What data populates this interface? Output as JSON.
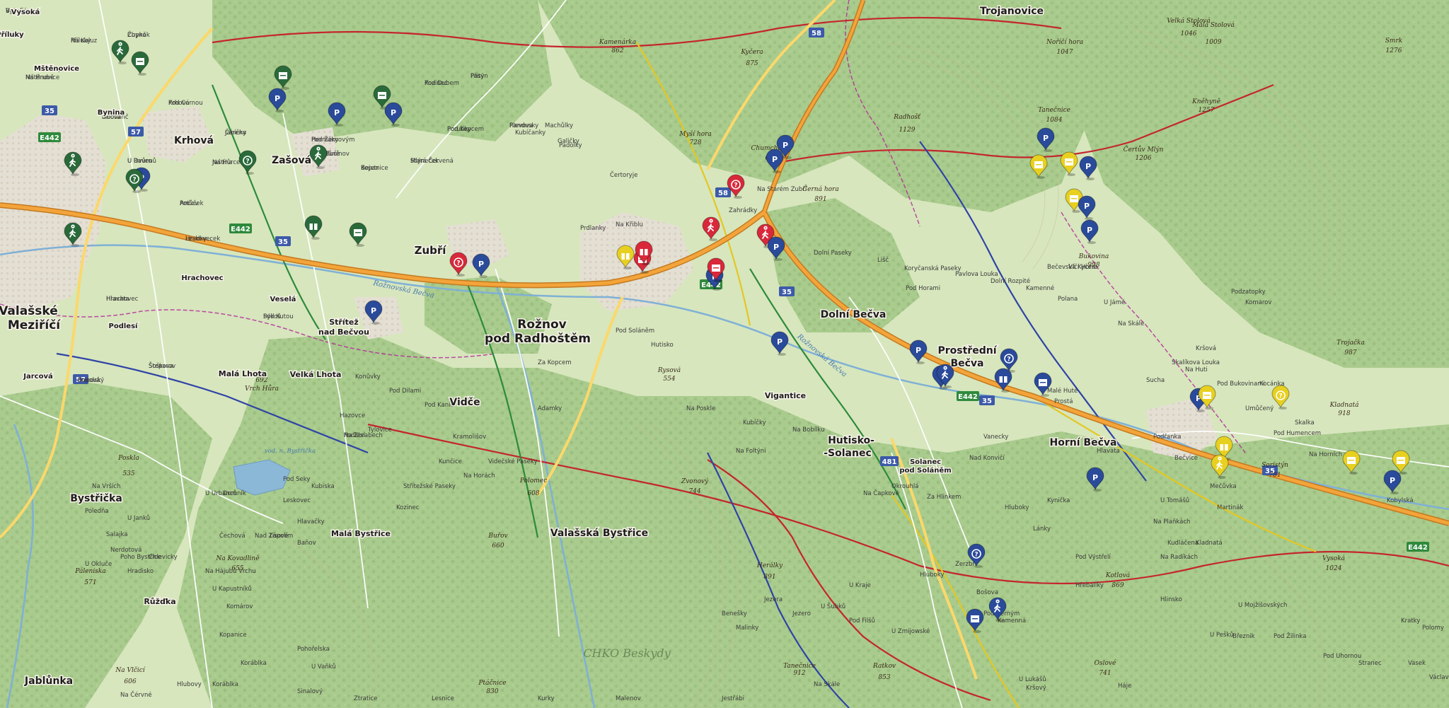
{
  "towns": [
    {
      "id": "valasske-mezirici",
      "lines": [
        "Valašské",
        "Meziříčí"
      ],
      "size": "large"
    },
    {
      "id": "roznov",
      "lines": [
        "Rožnov",
        "pod Radhoštěm"
      ],
      "size": "large"
    },
    {
      "id": "zubri",
      "lines": [
        "Zubří"
      ],
      "size": "medium"
    },
    {
      "id": "dolni-becva",
      "lines": [
        "Dolní Bečva"
      ],
      "size": "medium"
    },
    {
      "id": "prostredni-becva",
      "lines": [
        "Prostřední",
        "Bečva"
      ],
      "size": "medium"
    },
    {
      "id": "horni-becva",
      "lines": [
        "Horní Bečva"
      ],
      "size": "medium"
    },
    {
      "id": "hutisko",
      "lines": [
        "Hutisko-",
        "-Solanec"
      ],
      "size": "medium"
    },
    {
      "id": "valasska-bystrice",
      "lines": [
        "Valašská Bystřice"
      ],
      "size": "medium"
    },
    {
      "id": "vidce",
      "lines": [
        "Vidče"
      ],
      "size": "medium"
    },
    {
      "id": "trojanovice",
      "lines": [
        "Trojanovice"
      ],
      "size": "medium"
    },
    {
      "id": "krhova",
      "lines": [
        "Krhová"
      ],
      "size": "medium"
    },
    {
      "id": "zasova",
      "lines": [
        "Zašová"
      ],
      "size": "medium"
    },
    {
      "id": "bystricka",
      "lines": [
        "Bystřička"
      ],
      "size": "medium"
    },
    {
      "id": "jablunka",
      "lines": [
        "Jablůnka"
      ],
      "size": "medium"
    },
    {
      "id": "vigantice",
      "lines": [
        "Vigantice"
      ],
      "size": "small"
    },
    {
      "id": "strelec",
      "lines": [
        "Střítež",
        "nad Bečvou"
      ],
      "size": "small"
    },
    {
      "id": "mala-lhota",
      "lines": [
        "Malá Lhota"
      ],
      "size": "small"
    },
    {
      "id": "velka-lhota",
      "lines": [
        "Velká Lhota"
      ],
      "size": "small"
    },
    {
      "id": "mala-bystrice",
      "lines": [
        "Malá Bystřice"
      ],
      "size": "small"
    },
    {
      "id": "ruzdka",
      "lines": [
        "Růžďka"
      ],
      "size": "small"
    },
    {
      "id": "solanec",
      "lines": [
        "Solanec",
        "pod Soláněm"
      ],
      "size": "small"
    },
    {
      "id": "hrachovec",
      "lines": [
        "Hrachovec"
      ],
      "size": "small"
    },
    {
      "id": "podlesi",
      "lines": [
        "Podlesí"
      ],
      "size": "small"
    },
    {
      "id": "jarcova",
      "lines": [
        "Jarcová"
      ],
      "size": "small"
    },
    {
      "id": "vesela",
      "lines": [
        "Veselá"
      ],
      "size": "small"
    },
    {
      "id": "bynina",
      "lines": [
        "Bynina"
      ],
      "size": "small"
    },
    {
      "id": "mstenovice",
      "lines": [
        "Mštěnovice"
      ],
      "size": "small"
    },
    {
      "id": "vysoka",
      "lines": [
        "Vysoká"
      ],
      "size": "small"
    },
    {
      "id": "prilaky",
      "lines": [
        "Příluky"
      ],
      "size": "small"
    }
  ],
  "peaks": [
    {
      "id": "radhost",
      "name": "Radhošť",
      "elev": "1129"
    },
    {
      "id": "velka-stolova",
      "name": "Velká Stolová",
      "elev": "1046"
    },
    {
      "id": "mala-stolova",
      "name": "Malá Stolová",
      "elev": "1009"
    },
    {
      "id": "noricna-hora",
      "name": "Noříčí hora",
      "elev": "1047"
    },
    {
      "id": "tanecnice",
      "name": "Tanečnice",
      "elev": "1084"
    },
    {
      "id": "knehyne",
      "name": "Kněhyně",
      "elev": "1257"
    },
    {
      "id": "certuv-mlyn",
      "name": "Čertův Mlýn",
      "elev": "1206"
    },
    {
      "id": "cerna-hora",
      "name": "Černá hora",
      "elev": "891"
    },
    {
      "id": "chumchalka",
      "name": "Chumchalka",
      "elev": "634"
    },
    {
      "id": "kycera",
      "name": "Kyčera",
      "elev": "875"
    },
    {
      "id": "mysi-hora",
      "name": "Myší hora",
      "elev": "728"
    },
    {
      "id": "kamenarka",
      "name": "Kamenárka",
      "elev": "862"
    },
    {
      "id": "bukovina",
      "name": "Bukovina",
      "elev": "998"
    },
    {
      "id": "trojacka",
      "name": "Trojačka",
      "elev": "987"
    },
    {
      "id": "kladnata",
      "name": "Kladnatá",
      "elev": "918"
    },
    {
      "id": "vysoka-peak",
      "name": "Vysoká",
      "elev": "1024"
    },
    {
      "id": "smrk",
      "name": "Smrk",
      "elev": "1276"
    },
    {
      "id": "rysova",
      "name": "Rysová",
      "elev": "554"
    },
    {
      "id": "zvonovy",
      "name": "Zvonový",
      "elev": "744"
    },
    {
      "id": "heralky",
      "name": "Herálky",
      "elev": "891"
    },
    {
      "id": "tanecnice-s",
      "name": "Tanečnice",
      "elev": "912"
    },
    {
      "id": "ratkov",
      "name": "Ratkov",
      "elev": "853"
    },
    {
      "id": "ptacnice",
      "name": "Ptáčnice",
      "elev": "830"
    },
    {
      "id": "polomec",
      "name": "Polomec",
      "elev": "608"
    },
    {
      "id": "burov",
      "name": "Buřov",
      "elev": "660"
    },
    {
      "id": "paleniska",
      "name": "Páleniska",
      "elev": "571"
    },
    {
      "id": "poskla",
      "name": "Poskla",
      "elev": "535"
    },
    {
      "id": "vrch-hura",
      "name": "Vrch Hůra",
      "elev": "692"
    },
    {
      "id": "na-vlcici",
      "name": "Na Vlčicí",
      "elev": "606"
    },
    {
      "id": "na-kovadlinie",
      "name": "Na Kovadlině",
      "elev": "655"
    },
    {
      "id": "soristyn",
      "name": "Soristýn",
      "elev": "781"
    },
    {
      "id": "kotlova",
      "name": "Kotlová",
      "elev": "869"
    },
    {
      "id": "oslove",
      "name": "Oslové",
      "elev": "741"
    }
  ],
  "small_labels": [
    "Vysoká",
    "Příluky",
    "Čupka",
    "Obora",
    "Bynina",
    "Mštěnovice",
    "Krhová",
    "Janíčka",
    "Pod Žernovým",
    "Jaštína",
    "U Dvůru",
    "Potůček",
    "Hradky",
    "Hrachovec",
    "Sýkoš",
    "Šteparov",
    "Podlesí",
    "Sopová",
    "Tůně",
    "Kopanice",
    "Stará Červená",
    "Pod Dubem",
    "Přitýn",
    "Randusky",
    "Porubky",
    "Kubíčanky",
    "Machůlky",
    "Galičky",
    "Padolky",
    "Čertoryje",
    "Prdlanky",
    "Na Křiblu",
    "Zahrádky",
    "Na Starém Zubří",
    "Dolní Paseky",
    "Lišč",
    "Koryčanská Paseky",
    "Pod Horami",
    "Pavlova Louka",
    "Dolní Rozpité",
    "Kamenné",
    "Polana",
    "Bečevská Kyčera",
    "Vlčí Hora",
    "U Jámě",
    "Na Skále",
    "Sucha",
    "Skalíkova Louka",
    "Podzatopky",
    "Komarov",
    "Kršová",
    "Na Huti",
    "Pod Bukovinami",
    "Kocánka",
    "Umůčený",
    "Skalka",
    "Pod Humencem",
    "Na Horních",
    "Kobylská",
    "Mečůvka",
    "Martinák",
    "Na Plaňkách",
    "U Tomášů",
    "Kudláčena",
    "Kladnatá",
    "Na Radíkách",
    "Bečvice",
    "Podřanka",
    "Hlavata",
    "Malé Hutě",
    "Prostá",
    "Vanecky",
    "Okrouhlá",
    "Na Čapkové",
    "Za Hlinkem",
    "Hluboky",
    "Nad Konvičí",
    "Kynička",
    "Lánky",
    "Na Bobílku",
    "Na Foltýni",
    "Kubíčky",
    "Na Poskle",
    "Hutisko",
    "Pod Soláněm",
    "Za Kopcem",
    "Adamky",
    "Pod Kaničí",
    "Pod Dilami",
    "Konůvky",
    "Hazovce",
    "Tylovice",
    "Kramolišov",
    "Kunčice",
    "Na Horách",
    "Videčské Paseky",
    "Střítežské Paseky",
    "Kozinec",
    "Kubiska",
    "Pod Seky",
    "Leskovec",
    "Hlavačky",
    "Tisové",
    "Bañov",
    "Nad Zápolím",
    "U Janků",
    "Salajka",
    "Na Vrších",
    "Poledňa",
    "Nerdotová",
    "U Okluče",
    "Chlevicky",
    "Poho Bystřice",
    "Hradisko",
    "U Urbanců",
    "Domník",
    "Čechová",
    "Na Hájubů Vrchu",
    "U Kapustníků",
    "Komárov",
    "Kopanice",
    "Koráblka",
    "Koráblka",
    "Pohořelska",
    "U Vaňků",
    "Kršový",
    "U Lukášů",
    "Háje",
    "U Pešků",
    "Březnik",
    "Hřeballky",
    "Pod Výstřelí",
    "Hlinsko",
    "U Mojžíšovských",
    "Pod Žilinka",
    "Pod Uhornou",
    "Stranec",
    "Vasek",
    "Václavka",
    "Kratky",
    "Polomy",
    "U Zmijowské",
    "Pod Filšů",
    "U Kraje",
    "U Šubků",
    "Jezero",
    "Jezera",
    "Benešky",
    "Malinky",
    "Pod Černým",
    "Hluboky",
    "Zerzbří",
    "Bošova",
    "Kamenná",
    "Na Skále",
    "Jestřábi",
    "Malenov",
    "Kurky",
    "Lesnice",
    "Ztratice",
    "Sinalový",
    "Na Čérvné",
    "Hlubovy",
    "Bukeš",
    "Na Kaluz",
    "Zbyněk",
    "Milovanč",
    "U Dunku",
    "Na Hrubé",
    "Pod Cernou",
    "Čáreny",
    "Hermáky",
    "Na Hůrce",
    "U Ravenů",
    "Ančov",
    "Leskovecek",
    "Hlavata",
    "Pod Kutou",
    "Šoškova",
    "Na Zbrabech",
    "Poledský",
    "Bučinov",
    "Bejetr",
    "Mlýneček",
    "Kozinec",
    "Pasy",
    "Plevova",
    "Pod Kopcem"
  ],
  "roads": [
    "35",
    "35",
    "35",
    "35",
    "35",
    "57",
    "57",
    "58",
    "58",
    "481",
    "E442",
    "E442",
    "E442",
    "E442",
    "E442"
  ],
  "regions": [
    {
      "id": "chko",
      "name": "CHKO Beskydy"
    },
    {
      "id": "roznovska-becva",
      "name": "Rožnovská Bečva"
    },
    {
      "id": "roznovska-becva-2",
      "name": "Rožnovská Bečva"
    },
    {
      "id": "vodni-nadrz",
      "name": "vod. n. Bystřička"
    }
  ],
  "pins": [
    {
      "id": "p1",
      "color": "#2a6a3a",
      "icon": "hiker"
    },
    {
      "id": "p2",
      "color": "#2a6a3a",
      "icon": "museum"
    },
    {
      "id": "p3",
      "color": "#2a6a3a",
      "icon": "museum"
    },
    {
      "id": "p4",
      "color": "#2a4a9a",
      "icon": "parking"
    },
    {
      "id": "p5",
      "color": "#2a4a9a",
      "icon": "parking"
    },
    {
      "id": "p6",
      "color": "#2a6a3a",
      "icon": "museum"
    },
    {
      "id": "p7",
      "color": "#2a4a9a",
      "icon": "parking"
    },
    {
      "id": "p8",
      "color": "#2a6a3a",
      "icon": "hiker"
    },
    {
      "id": "p9",
      "color": "#2a6a3a",
      "icon": "info"
    },
    {
      "id": "p10",
      "color": "#2a4a9a",
      "icon": "parking"
    },
    {
      "id": "p11",
      "color": "#2a6a3a",
      "icon": "info"
    },
    {
      "id": "p12",
      "color": "#2a6a3a",
      "icon": "hiker"
    },
    {
      "id": "p13",
      "color": "#2a6a3a",
      "icon": "hiker"
    },
    {
      "id": "p14",
      "color": "#2a6a3a",
      "icon": "gift"
    },
    {
      "id": "p15",
      "color": "#2a6a3a",
      "icon": "museum"
    },
    {
      "id": "p16",
      "color": "#d8283a",
      "icon": "info"
    },
    {
      "id": "p17",
      "color": "#2a4a9a",
      "icon": "parking"
    },
    {
      "id": "p18",
      "color": "#2a4a9a",
      "icon": "parking"
    },
    {
      "id": "p19",
      "color": "#d8283a",
      "icon": "museum"
    },
    {
      "id": "p20",
      "color": "#e8d020",
      "icon": "gift"
    },
    {
      "id": "p21",
      "color": "#d8283a",
      "icon": "gift"
    },
    {
      "id": "p22",
      "color": "#d8283a",
      "icon": "hiker"
    },
    {
      "id": "p23",
      "color": "#d8283a",
      "icon": "hiker"
    },
    {
      "id": "p24",
      "color": "#2a4a9a",
      "icon": "parking"
    },
    {
      "id": "p25",
      "color": "#2a4a9a",
      "icon": "parking"
    },
    {
      "id": "p26",
      "color": "#d8283a",
      "icon": "info"
    },
    {
      "id": "p27",
      "color": "#2a4a9a",
      "icon": "parking"
    },
    {
      "id": "p28",
      "color": "#d8283a",
      "icon": "museum"
    },
    {
      "id": "p29",
      "color": "#2a4a9a",
      "icon": "parking"
    },
    {
      "id": "p30",
      "color": "#2a4a9a",
      "icon": "parking"
    },
    {
      "id": "p31",
      "color": "#2a4a9a",
      "icon": "parking"
    },
    {
      "id": "p32",
      "color": "#2a4a9a",
      "icon": "parking"
    },
    {
      "id": "p33",
      "color": "#2a4a9a",
      "icon": "hiker"
    },
    {
      "id": "p34",
      "color": "#2a4a9a",
      "icon": "info"
    },
    {
      "id": "p35",
      "color": "#2a4a9a",
      "icon": "gift"
    },
    {
      "id": "p36",
      "color": "#2a4a9a",
      "icon": "museum"
    },
    {
      "id": "p37",
      "color": "#2a4a9a",
      "icon": "parking"
    },
    {
      "id": "p38",
      "color": "#e8d020",
      "icon": "museum"
    },
    {
      "id": "p39",
      "color": "#e8d020",
      "icon": "museum"
    },
    {
      "id": "p40",
      "color": "#2a4a9a",
      "icon": "parking"
    },
    {
      "id": "p41",
      "color": "#e8d020",
      "icon": "museum"
    },
    {
      "id": "p42",
      "color": "#2a4a9a",
      "icon": "parking"
    },
    {
      "id": "p43",
      "color": "#2a4a9a",
      "icon": "parking"
    },
    {
      "id": "p44",
      "color": "#2a4a9a",
      "icon": "parking"
    },
    {
      "id": "p45",
      "color": "#e8d020",
      "icon": "museum"
    },
    {
      "id": "p46",
      "color": "#e8d020",
      "icon": "info"
    },
    {
      "id": "p47",
      "color": "#e8d020",
      "icon": "gift"
    },
    {
      "id": "p48",
      "color": "#e8d020",
      "icon": "hiker"
    },
    {
      "id": "p49",
      "color": "#e8d020",
      "icon": "museum"
    },
    {
      "id": "p50",
      "color": "#e8d020",
      "icon": "museum"
    },
    {
      "id": "p51",
      "color": "#2a4a9a",
      "icon": "parking"
    },
    {
      "id": "p52",
      "color": "#2a4a9a",
      "icon": "parking"
    },
    {
      "id": "p53",
      "color": "#2a4a9a",
      "icon": "info"
    },
    {
      "id": "p54",
      "color": "#2a4a9a",
      "icon": "museum"
    },
    {
      "id": "p55",
      "color": "#2a4a9a",
      "icon": "hiker"
    }
  ],
  "colors": {
    "lowland": "#d7e6bd",
    "forest": "#a6c98a",
    "forest_dark": "#8fb874",
    "urban": "#e2ddd2",
    "water": "#8cb8d8",
    "motorway": "#f3a43a",
    "motorway_edge": "#c47a20",
    "main_road": "#fbd86b",
    "minor_road": "#ffffff",
    "trail_red": "#c4262e",
    "trail_blue": "#2f43a6",
    "trail_green": "#2d8a3a",
    "trail_yellow": "#e4c722",
    "boundary": "#b3249a"
  }
}
